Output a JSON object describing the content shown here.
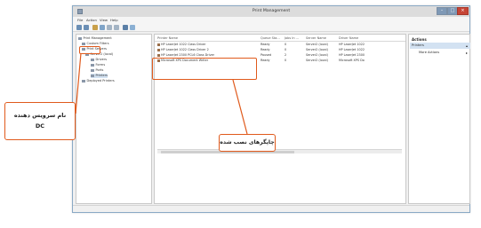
{
  "window": {
    "title": "Print Management"
  },
  "menu": [
    "File",
    "Action",
    "View",
    "Help"
  ],
  "tree": [
    "Print Management",
    "Custom Filters",
    "Print Servers",
    "Server2 (local)",
    "Drivers",
    "Forms",
    "Ports",
    "Printers",
    "Deployed Printers"
  ],
  "columns": [
    "Printer Name",
    "Queue Sta...",
    "Jobs In ...",
    "Server Name",
    "Driver Name"
  ],
  "rows": [
    [
      "HP LaserJet 1022 Class Driver",
      "Ready",
      "0",
      "Server2 (local)",
      "HP LaserJet 1022"
    ],
    [
      "HP LaserJet 1022 Class Driver 2",
      "Ready",
      "0",
      "Server2 (local)",
      "HP LaserJet 1022"
    ],
    [
      "HP LaserJet 2300 PCL6 Class Driver",
      "Paused",
      "2",
      "Server2 (local)",
      "HP LaserJet 2300"
    ],
    [
      "Microsoft XPS Document Writer",
      "Ready",
      "0",
      "Server2 (local)",
      "Microsoft XPS Do"
    ]
  ],
  "actions": {
    "header": "Actions",
    "section": "Printers",
    "item": "More Actions"
  },
  "callouts": {
    "server_line1": "نام سرویس دهنده",
    "server_line2": "DC",
    "printers": "چاپگرهای نصب شده"
  },
  "colors": {
    "accent": "#e05a1c",
    "close": "#c64536",
    "selection": "#d3e2f2"
  }
}
